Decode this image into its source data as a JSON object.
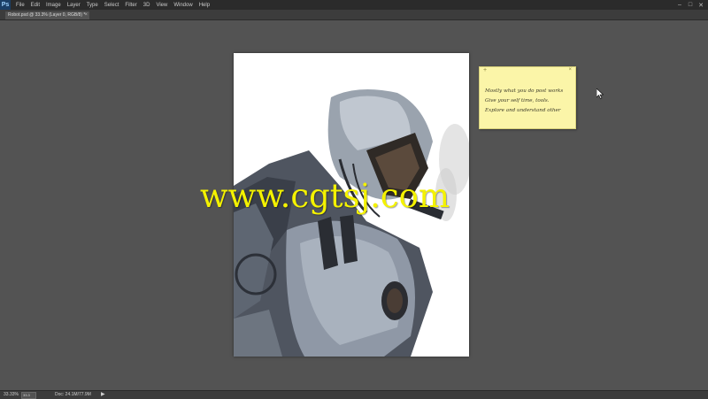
{
  "app": {
    "logo": "Ps",
    "menu": [
      "File",
      "Edit",
      "Image",
      "Layer",
      "Type",
      "Select",
      "Filter",
      "3D",
      "View",
      "Window",
      "Help"
    ],
    "window_controls": [
      "–",
      "□",
      "✕"
    ]
  },
  "document": {
    "tab_title": "Robot.psd @ 33.3% (Layer 0, RGB/8) *",
    "tab_close": "×"
  },
  "note": {
    "plus": "+",
    "close": "×",
    "lines": [
      "Mostly what you do post works",
      "Give your self time, tools.",
      "Explore and understand other"
    ]
  },
  "watermark": "www.cgtsj.com",
  "status": {
    "zoom": "33.33%",
    "zoom_value": "33.3",
    "doc": "Doc: 24.1M/77.9M",
    "arrow": "▶"
  },
  "colors": {
    "workspace": "#535353",
    "menubar": "#2b2b2b",
    "note": "#fbf5a8",
    "watermark": "#f4f200"
  }
}
